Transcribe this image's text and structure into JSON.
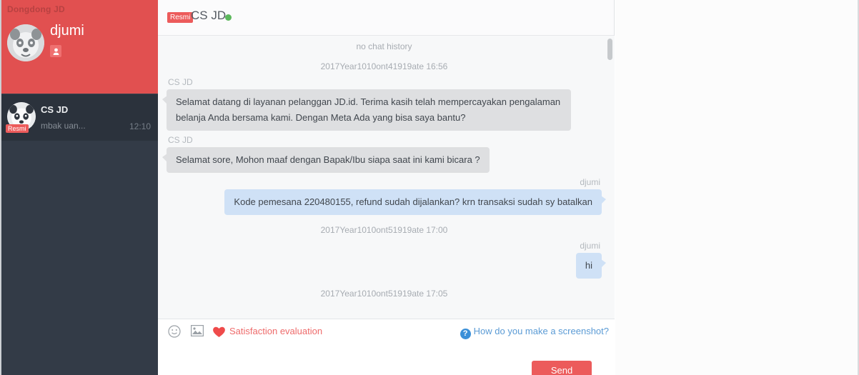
{
  "app": {
    "title": "Dongdong JD",
    "accent_red": "#e15050",
    "sidebar_dark": "#2b323c",
    "link_blue": "#5b9bd5"
  },
  "sidebar": {
    "me": {
      "name": "djumi",
      "avatar_icon": "panda-face-avatar",
      "role_badge_icon": "user-icon"
    },
    "conversations": [
      {
        "name": "CS JD",
        "preview": "mbak uan...",
        "time": "12:10",
        "badge": "Resmi",
        "avatar_icon": "panda-face-avatar"
      }
    ]
  },
  "chat": {
    "header": {
      "badge": "Resmi",
      "title": "CS JD",
      "status_icon": "online-dot",
      "status_color": "#5cb85c"
    },
    "messages": [
      {
        "kind": "system",
        "text": "no chat history"
      },
      {
        "kind": "time",
        "text": "2017Year1010ont41919ate 16:56"
      },
      {
        "kind": "in",
        "sender": "CS JD",
        "text": "Selamat datang di layanan pelanggan JD.id. Terima kasih telah mempercayakan pengalaman belanja Anda bersama kami. Dengan Meta Ada yang bisa saya bantu?"
      },
      {
        "kind": "in",
        "sender": "CS JD",
        "text": "Selamat sore,  Mohon maaf dengan Bapak/Ibu siapa saat ini kami bicara ?"
      },
      {
        "kind": "out",
        "sender": "djumi",
        "text": "Kode pemesana 220480155, refund sudah dijalankan? krn transaksi sudah sy batalkan"
      },
      {
        "kind": "time",
        "text": "2017Year1010ont51919ate 17:00"
      },
      {
        "kind": "out",
        "sender": "djumi",
        "text": "hi",
        "narrow": true
      },
      {
        "kind": "time",
        "text": "2017Year1010ont51919ate 17:05"
      }
    ]
  },
  "composer": {
    "emoji_icon": "smiley-icon",
    "image_icon": "image-icon",
    "heart_icon": "heart-icon",
    "satisfaction_label": "Satisfaction evaluation",
    "help_icon": "question-mark-icon",
    "help_label": "How do you make a screenshot?",
    "input_value": "",
    "input_placeholder": "",
    "send_label": "Send"
  }
}
